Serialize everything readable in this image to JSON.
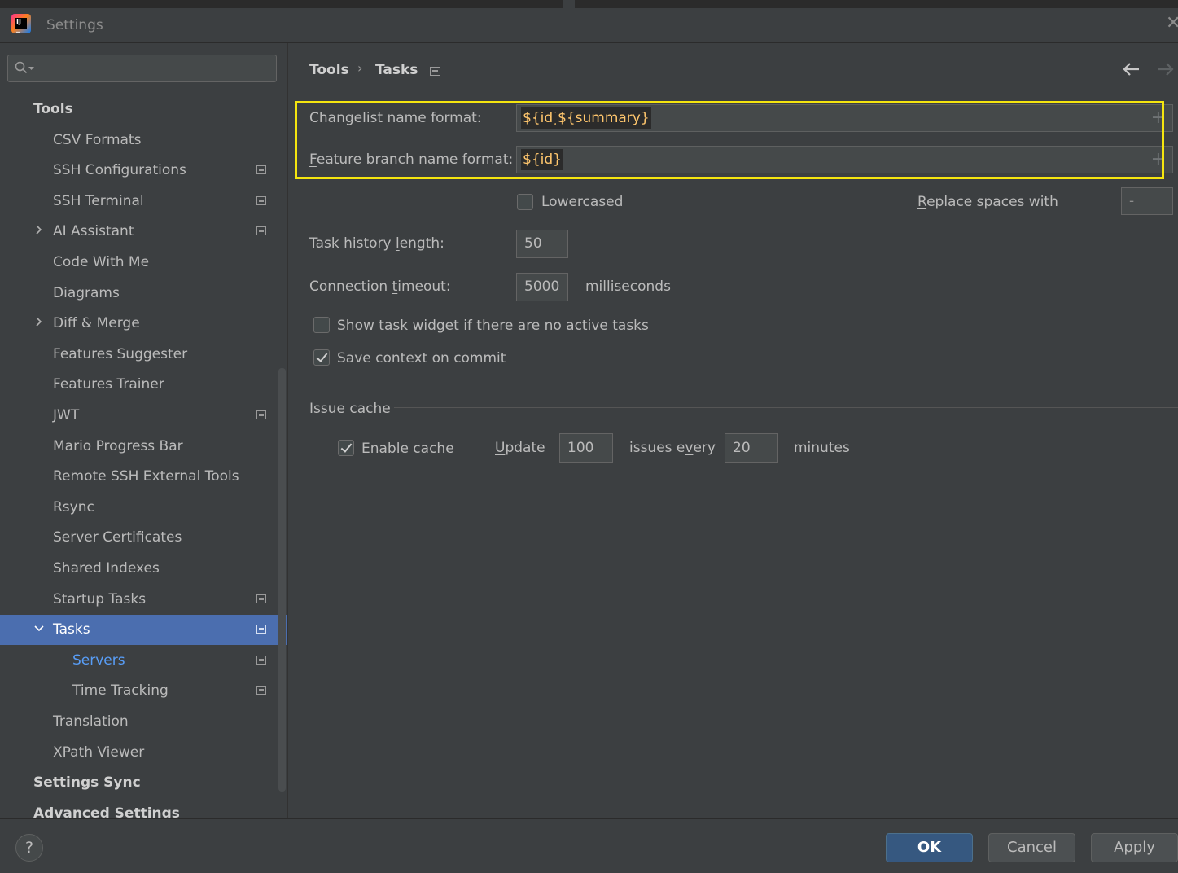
{
  "window": {
    "title": "Settings"
  },
  "search": {
    "placeholder": ""
  },
  "sidebar": {
    "items": [
      {
        "label": "Tools",
        "kind": "group"
      },
      {
        "label": "CSV Formats"
      },
      {
        "label": "SSH Configurations",
        "project_icon": true
      },
      {
        "label": "SSH Terminal",
        "project_icon": true
      },
      {
        "label": "AI Assistant",
        "expandable": true,
        "project_icon": true
      },
      {
        "label": "Code With Me"
      },
      {
        "label": "Diagrams"
      },
      {
        "label": "Diff & Merge",
        "expandable": true
      },
      {
        "label": "Features Suggester"
      },
      {
        "label": "Features Trainer"
      },
      {
        "label": "JWT",
        "project_icon": true
      },
      {
        "label": "Mario Progress Bar"
      },
      {
        "label": "Remote SSH External Tools"
      },
      {
        "label": "Rsync"
      },
      {
        "label": "Server Certificates"
      },
      {
        "label": "Shared Indexes"
      },
      {
        "label": "Startup Tasks",
        "project_icon": true
      },
      {
        "label": "Tasks",
        "expanded": true,
        "selected": true,
        "project_icon": true
      },
      {
        "label": "Servers",
        "level": 2,
        "project_icon": true
      },
      {
        "label": "Time Tracking",
        "level": 2,
        "project_icon": true
      },
      {
        "label": "Translation"
      },
      {
        "label": "XPath Viewer"
      },
      {
        "label": "Settings Sync",
        "kind": "group"
      },
      {
        "label": "Advanced Settings",
        "kind": "group"
      }
    ]
  },
  "breadcrumb": {
    "parent": "Tools",
    "current": "Tasks"
  },
  "form": {
    "changelist": {
      "label_mnemonic": "C",
      "label_rest": "hangelist name format:",
      "tokens": [
        "${id}",
        "${summary}"
      ]
    },
    "feature_branch": {
      "label_mnemonic": "F",
      "label_rest": "eature branch name format:",
      "tokens": [
        "${id}"
      ]
    },
    "lowercased": {
      "label": "Lowercased",
      "checked": false
    },
    "replace_spaces": {
      "label_mnemonic": "R",
      "label_rest": "eplace spaces with",
      "value": "-"
    },
    "task_history": {
      "label_pre": "Task history ",
      "label_mnemonic": "l",
      "label_rest": "ength:",
      "value": "50"
    },
    "connection_timeout": {
      "label_pre": "Connection ",
      "label_mnemonic": "t",
      "label_rest": "imeout:",
      "value": "5000",
      "unit": "milliseconds"
    },
    "show_widget": {
      "label": "Show task widget if there are no active tasks",
      "checked": false
    },
    "save_context": {
      "label": "Save context on commit",
      "checked": true
    }
  },
  "issue_cache": {
    "title": "Issue cache",
    "enable": {
      "label": "Enable cache",
      "checked": true
    },
    "update_mnemonic": "U",
    "update_rest": "pdate",
    "issues_value": "100",
    "issues_pre": "issues e",
    "issues_mnemonic": "v",
    "issues_rest": "ery",
    "minutes_value": "20",
    "minutes_label": "minutes"
  },
  "footer": {
    "help": "?",
    "ok": "OK",
    "cancel": "Cancel",
    "apply": "Apply"
  },
  "colors": {
    "highlight": "#f5e50f",
    "selection": "#4b6eaf",
    "token": "#ffc66d",
    "link": "#589df6"
  }
}
